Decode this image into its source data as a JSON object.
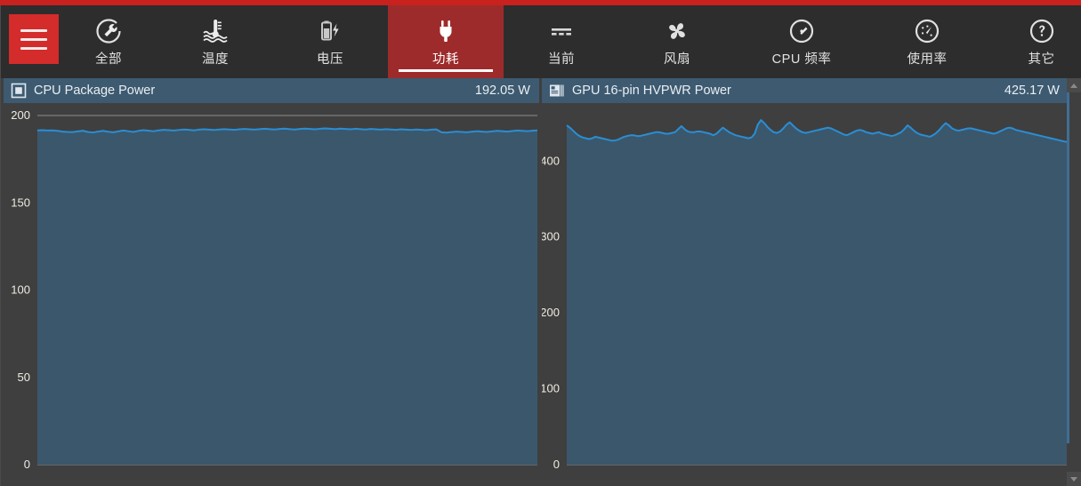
{
  "app": {
    "accent_red": "#c9211e",
    "toolbar_bg": "#2d2d2d",
    "active_tab_bg": "#9e2b2b",
    "panel_header_bg": "#3d5a70",
    "chart_fill": "#3b576c",
    "chart_line": "#2a8ed4",
    "background": "#3f3f3f"
  },
  "toolbar": {
    "menu_label": "菜单",
    "tabs": [
      {
        "label": "全部",
        "icon": "gauge-wrench-icon",
        "active": false
      },
      {
        "label": "温度",
        "icon": "thermometer-icon",
        "active": false
      },
      {
        "label": "电压",
        "icon": "battery-bolt-icon",
        "active": false
      },
      {
        "label": "功耗",
        "icon": "power-plug-icon",
        "active": true
      },
      {
        "label": "当前",
        "icon": "dashes-icon",
        "active": false
      },
      {
        "label": "风扇",
        "icon": "fan-icon",
        "active": false
      },
      {
        "label": "CPU 频率",
        "icon": "speedometer-icon",
        "active": false
      },
      {
        "label": "使用率",
        "icon": "usage-meter-icon",
        "active": false
      },
      {
        "label": "其它",
        "icon": "question-circle-icon",
        "active": false
      }
    ]
  },
  "panels": [
    {
      "id": "cpu-package-power",
      "icon": "cpu-chip-icon",
      "title": "CPU Package Power",
      "value": "192.05 W"
    },
    {
      "id": "gpu-16pin-hvpwr-power",
      "icon": "gpu-card-icon",
      "title": "GPU 16-pin HVPWR Power",
      "value": "425.17 W"
    }
  ],
  "scrollbar": {
    "up_label": "向上滚动",
    "down_label": "向下滚动",
    "thumb_label": "滚动条滑块"
  },
  "chart_data": [
    {
      "type": "area",
      "id": "cpu-package-power",
      "title": "CPU Package Power",
      "unit": "W",
      "current_value": 192.05,
      "xlabel": "",
      "ylabel": "",
      "ylim": [
        0,
        200
      ],
      "yticks": [
        0,
        50,
        100,
        150,
        200
      ],
      "grid": true,
      "legend": "none",
      "values": [
        191.5,
        191.6,
        191.4,
        191.5,
        191.2,
        190.8,
        190.6,
        190.5,
        190.9,
        191.3,
        190.6,
        190.3,
        190.8,
        191.2,
        190.7,
        190.4,
        190.9,
        191.4,
        191.0,
        190.6,
        191.2,
        191.6,
        191.3,
        191.0,
        191.5,
        191.8,
        191.6,
        191.4,
        191.7,
        192.0,
        191.8,
        191.5,
        191.9,
        192.1,
        191.9,
        191.7,
        192.0,
        192.2,
        192.0,
        191.8,
        192.1,
        192.3,
        192.1,
        191.9,
        192.2,
        192.4,
        192.2,
        192.0,
        192.3,
        192.5,
        192.2,
        192.0,
        192.3,
        192.5,
        192.3,
        192.1,
        192.4,
        192.6,
        192.4,
        192.2,
        192.5,
        192.3,
        192.1,
        192.4,
        192.2,
        192.0,
        192.3,
        192.1,
        191.9,
        192.2,
        192.0,
        191.8,
        192.1,
        191.9,
        191.7,
        192.0,
        191.8,
        191.6,
        191.9,
        192.05,
        190.4,
        190.2,
        190.5,
        190.8,
        190.6,
        190.4,
        190.7,
        191.0,
        190.8,
        190.6,
        190.9,
        191.2,
        191.0,
        190.8,
        191.1,
        191.4,
        191.2,
        191.0,
        191.3,
        191.5
      ]
    },
    {
      "type": "area",
      "id": "gpu-16pin-hvpwr-power",
      "title": "GPU 16-pin HVPWR Power",
      "unit": "W",
      "current_value": 425.17,
      "xlabel": "",
      "ylabel": "",
      "ylim": [
        0,
        460
      ],
      "yticks": [
        0,
        100,
        200,
        300,
        400
      ],
      "grid": true,
      "legend": "none",
      "values": [
        447,
        444,
        440,
        436,
        433,
        431,
        430,
        429,
        430,
        432,
        431,
        430,
        429,
        428,
        427,
        427,
        428,
        430,
        432,
        433,
        434,
        434,
        433,
        433,
        434,
        435,
        436,
        437,
        438,
        438,
        437,
        436,
        436,
        437,
        438,
        442,
        446,
        442,
        439,
        438,
        438,
        439,
        439,
        438,
        437,
        436,
        434,
        436,
        440,
        444,
        441,
        438,
        436,
        434,
        433,
        432,
        431,
        430,
        431,
        436,
        448,
        454,
        450,
        445,
        441,
        438,
        437,
        439,
        443,
        448,
        451,
        447,
        443,
        440,
        438,
        437,
        438,
        439,
        440,
        441,
        442,
        443,
        444,
        443,
        441,
        439,
        437,
        435,
        434,
        436,
        438,
        440,
        441,
        440,
        438,
        437,
        436,
        437,
        438,
        436,
        435,
        434,
        433,
        434,
        436,
        438,
        442,
        447,
        444,
        440,
        437,
        435,
        434,
        433,
        432,
        434,
        437,
        441,
        446,
        450,
        447,
        443,
        441,
        440,
        441,
        442,
        443,
        443,
        442,
        441,
        440,
        439,
        438,
        437,
        436,
        437,
        439,
        441,
        443,
        444,
        443,
        441,
        440,
        439,
        438,
        437,
        436,
        435,
        434,
        433,
        432,
        431,
        430,
        429,
        428,
        427,
        426,
        425.17
      ]
    }
  ]
}
